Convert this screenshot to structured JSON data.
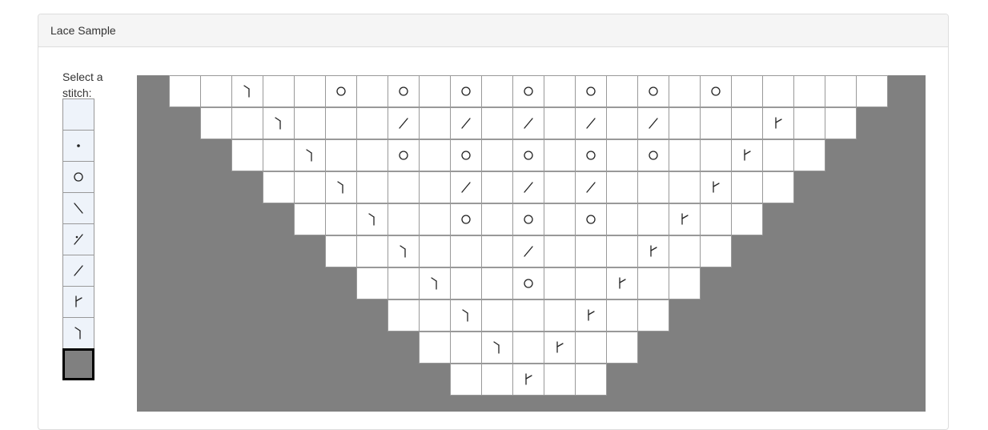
{
  "panel": {
    "title": "Lace Sample"
  },
  "palette": {
    "label": "Select a stitch:",
    "stitches": [
      {
        "symbol": "knit",
        "name": "knit"
      },
      {
        "symbol": "purl",
        "name": "purl"
      },
      {
        "symbol": "yo",
        "name": "yarn-over"
      },
      {
        "symbol": "ssk",
        "name": "ssk"
      },
      {
        "symbol": "sk2p",
        "name": "double-decrease"
      },
      {
        "symbol": "k2tog",
        "name": "k2tog"
      },
      {
        "symbol": "right-dec",
        "name": "right-decrease"
      },
      {
        "symbol": "left-dec",
        "name": "left-decrease"
      },
      {
        "symbol": "nostitch",
        "name": "no-stitch",
        "selected": true
      }
    ]
  },
  "chart": {
    "columns": 25,
    "rows": [
      [
        "X",
        "K",
        "K",
        "L",
        "K",
        "K",
        "O",
        "K",
        "O",
        "K",
        "O",
        "K",
        "O",
        "K",
        "O",
        "K",
        "O",
        "K",
        "O",
        "K",
        "K",
        "K",
        "K",
        "K",
        "X"
      ],
      [
        "X",
        "X",
        "K",
        "K",
        "L",
        "K",
        "K",
        "K",
        "/",
        "K",
        "/",
        "K",
        "/",
        "K",
        "/",
        "K",
        "/",
        "K",
        "K",
        "K",
        "R",
        "K",
        "K",
        "X",
        "X"
      ],
      [
        "X",
        "X",
        "X",
        "K",
        "K",
        "L",
        "K",
        "K",
        "O",
        "K",
        "O",
        "K",
        "O",
        "K",
        "O",
        "K",
        "O",
        "K",
        "K",
        "R",
        "K",
        "K",
        "X",
        "X",
        "X"
      ],
      [
        "X",
        "X",
        "X",
        "X",
        "K",
        "K",
        "L",
        "K",
        "K",
        "K",
        "/",
        "K",
        "/",
        "K",
        "/",
        "K",
        "K",
        "K",
        "R",
        "K",
        "K",
        "X",
        "X",
        "X",
        "X"
      ],
      [
        "X",
        "X",
        "X",
        "X",
        "X",
        "K",
        "K",
        "L",
        "K",
        "K",
        "O",
        "K",
        "O",
        "K",
        "O",
        "K",
        "K",
        "R",
        "K",
        "K",
        "X",
        "X",
        "X",
        "X",
        "X"
      ],
      [
        "X",
        "X",
        "X",
        "X",
        "X",
        "X",
        "K",
        "K",
        "L",
        "K",
        "K",
        "K",
        "/",
        "K",
        "K",
        "K",
        "R",
        "K",
        "K",
        "X",
        "X",
        "X",
        "X",
        "X",
        "X"
      ],
      [
        "X",
        "X",
        "X",
        "X",
        "X",
        "X",
        "X",
        "K",
        "K",
        "L",
        "K",
        "K",
        "O",
        "K",
        "K",
        "R",
        "K",
        "K",
        "X",
        "X",
        "X",
        "X",
        "X",
        "X",
        "X"
      ],
      [
        "X",
        "X",
        "X",
        "X",
        "X",
        "X",
        "X",
        "X",
        "K",
        "K",
        "L",
        "K",
        "K",
        "K",
        "R",
        "K",
        "K",
        "X",
        "X",
        "X",
        "X",
        "X",
        "X",
        "X",
        "X"
      ],
      [
        "X",
        "X",
        "X",
        "X",
        "X",
        "X",
        "X",
        "X",
        "X",
        "K",
        "K",
        "L",
        "K",
        "R",
        "K",
        "K",
        "X",
        "X",
        "X",
        "X",
        "X",
        "X",
        "X",
        "X",
        "X"
      ],
      [
        "X",
        "X",
        "X",
        "X",
        "X",
        "X",
        "X",
        "X",
        "X",
        "X",
        "K",
        "K",
        "R",
        "K",
        "K",
        "X",
        "X",
        "X",
        "X",
        "X",
        "X",
        "X",
        "X",
        "X",
        "X"
      ]
    ],
    "colors": {
      "background": "#808080",
      "cell": "#ffffff",
      "grid": "#999999"
    }
  }
}
